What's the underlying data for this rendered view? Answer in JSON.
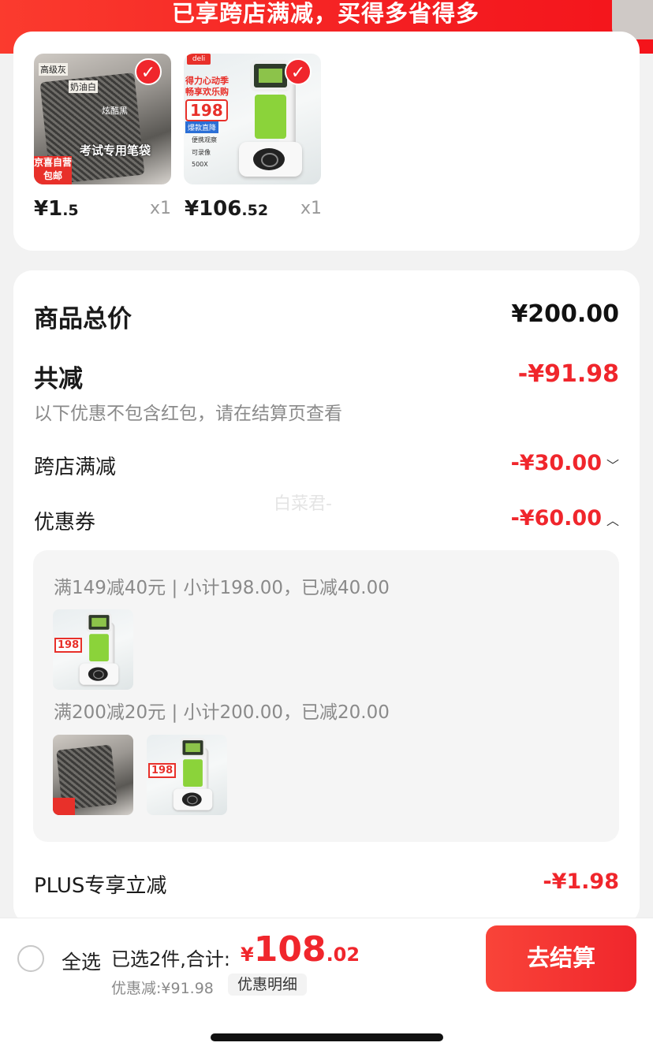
{
  "banner": {
    "text": "已享跨店满减，买得多省得多"
  },
  "products": [
    {
      "name": "pencil-pouch",
      "price_int": "¥1",
      "price_dec": ".5",
      "qty": "x1",
      "img_labels": {
        "a": "高级灰",
        "b": "奶油白",
        "c": "炫酷黑",
        "caption": "考试专用笔袋",
        "tag_line1": "京喜自营",
        "tag_line2": "包邮"
      }
    },
    {
      "name": "microscope",
      "price_int": "¥106",
      "price_dec": ".52",
      "qty": "x1",
      "img_labels": {
        "logo": "deli",
        "promo": "得力心动季 畅享欢乐购",
        "price": "198",
        "tag": "爆款直降",
        "feat1": "便携观察",
        "feat2": "可录像",
        "feat3": "500X"
      }
    }
  ],
  "summary": {
    "total_label": "商品总价",
    "total_value": "¥200.00",
    "reduce_label": "共减",
    "reduce_value": "-¥91.98",
    "note": "以下优惠不包含红包，请在结算页查看",
    "cross_store_label": "跨店满减",
    "cross_store_value": "-¥30.00",
    "coupon_label": "优惠券",
    "coupon_value": "-¥60.00",
    "plus_label": "PLUS专享立减",
    "plus_value": "-¥1.98",
    "watermark": "白菜君-"
  },
  "coupons": [
    {
      "rule": "满149减40元 | 小计198.00，已减40.00"
    },
    {
      "rule": "满200减20元 | 小计200.00，已减20.00"
    }
  ],
  "footer": {
    "select_all": "全选",
    "selected_text": "已选2件,合计:",
    "total_currency": "¥",
    "total_int": "108",
    "total_dec": ".02",
    "discount_text": "优惠减:¥91.98",
    "detail_chip": "优惠明细",
    "checkout": "去结算"
  },
  "icons": {
    "check": "check-icon",
    "chevron_down": "chevron-down-icon",
    "chevron_up": "chevron-up-icon",
    "radio": "radio-unchecked-icon"
  },
  "colors": {
    "accent_red": "#f0262c",
    "banner_red": "#f41f22",
    "muted_gray": "#8a8a8a"
  }
}
